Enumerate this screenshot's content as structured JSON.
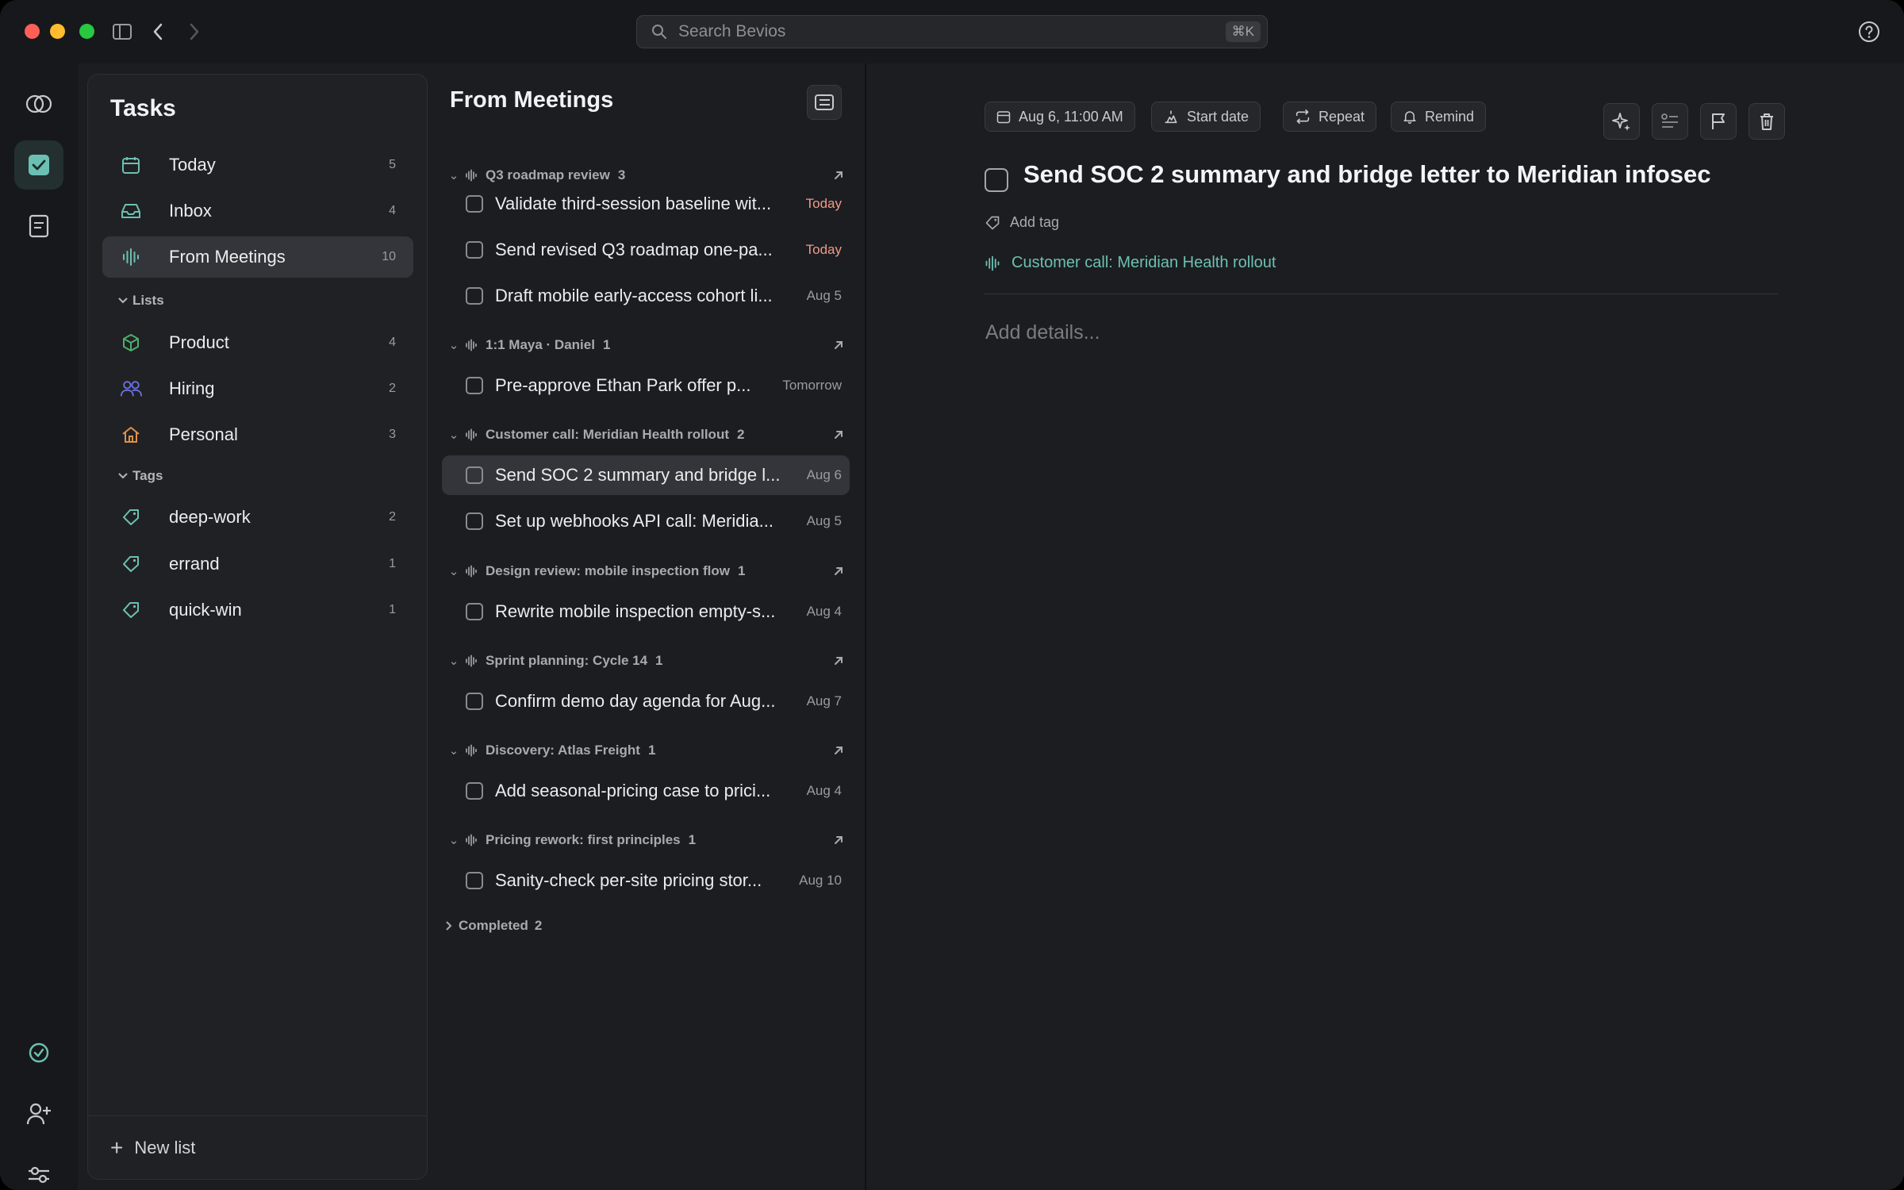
{
  "search": {
    "placeholder": "Search Bevios",
    "shortcut": "⌘K"
  },
  "sidebar": {
    "title": "Tasks",
    "nav": [
      {
        "label": "Today",
        "count": "5",
        "icon": "calendar-icon"
      },
      {
        "label": "Inbox",
        "count": "4",
        "icon": "inbox-icon"
      },
      {
        "label": "From Meetings",
        "count": "10",
        "icon": "waveform-icon"
      }
    ],
    "lists_heading": "Lists",
    "lists": [
      {
        "label": "Product",
        "count": "4",
        "icon": "cube-icon"
      },
      {
        "label": "Hiring",
        "count": "2",
        "icon": "people-icon"
      },
      {
        "label": "Personal",
        "count": "3",
        "icon": "house-icon"
      }
    ],
    "tags_heading": "Tags",
    "tags": [
      {
        "label": "deep-work",
        "count": "2",
        "icon": "tag-icon"
      },
      {
        "label": "errand",
        "count": "1",
        "icon": "tag-icon"
      },
      {
        "label": "quick-win",
        "count": "1",
        "icon": "tag-icon"
      }
    ],
    "new_list": "New list"
  },
  "list": {
    "title": "From Meetings",
    "groups": [
      {
        "name": "Q3 roadmap review",
        "count": "3",
        "tasks": [
          {
            "title": "Validate third-session baseline wit...",
            "due": "Today"
          },
          {
            "title": "Send revised Q3 roadmap one-pa...",
            "due": "Today"
          },
          {
            "title": "Draft mobile early-access cohort li...",
            "due": "Aug 5"
          }
        ]
      },
      {
        "name": "1:1 Maya · Daniel",
        "count": "1",
        "tasks": [
          {
            "title": "Pre-approve Ethan Park offer p...",
            "due": "Tomorrow"
          }
        ]
      },
      {
        "name": "Customer call: Meridian Health rollout",
        "count": "2",
        "tasks": [
          {
            "title": "Send SOC 2 summary and bridge l...",
            "due": "Aug 6"
          },
          {
            "title": "Set up webhooks API call: Meridia...",
            "due": "Aug 5"
          }
        ]
      },
      {
        "name": "Design review: mobile inspection flow",
        "count": "1",
        "tasks": [
          {
            "title": "Rewrite mobile inspection empty-s...",
            "due": "Aug 4"
          }
        ]
      },
      {
        "name": "Sprint planning: Cycle 14",
        "count": "1",
        "tasks": [
          {
            "title": "Confirm demo day agenda for Aug...",
            "due": "Aug 7"
          }
        ]
      },
      {
        "name": "Discovery: Atlas Freight",
        "count": "1",
        "tasks": [
          {
            "title": "Add seasonal-pricing case to prici...",
            "due": "Aug 4"
          }
        ]
      },
      {
        "name": "Pricing rework: first principles",
        "count": "1",
        "tasks": [
          {
            "title": "Sanity-check per-site pricing stor...",
            "due": "Aug 10"
          }
        ]
      }
    ],
    "completed_label": "Completed",
    "completed_count": "2"
  },
  "detail": {
    "due_chip": "Aug 6, 11:00 AM",
    "start_chip": "Start date",
    "repeat_chip": "Repeat",
    "remind_chip": "Remind",
    "title": "Send SOC 2 summary and bridge letter to Meridian infosec",
    "add_tag": "Add tag",
    "meeting": "Customer call: Meridian Health rollout",
    "details_placeholder": "Add details..."
  },
  "colors": {
    "accent": "#6cc0b3",
    "today": "#f09a8a",
    "background": "#1c1d20"
  }
}
